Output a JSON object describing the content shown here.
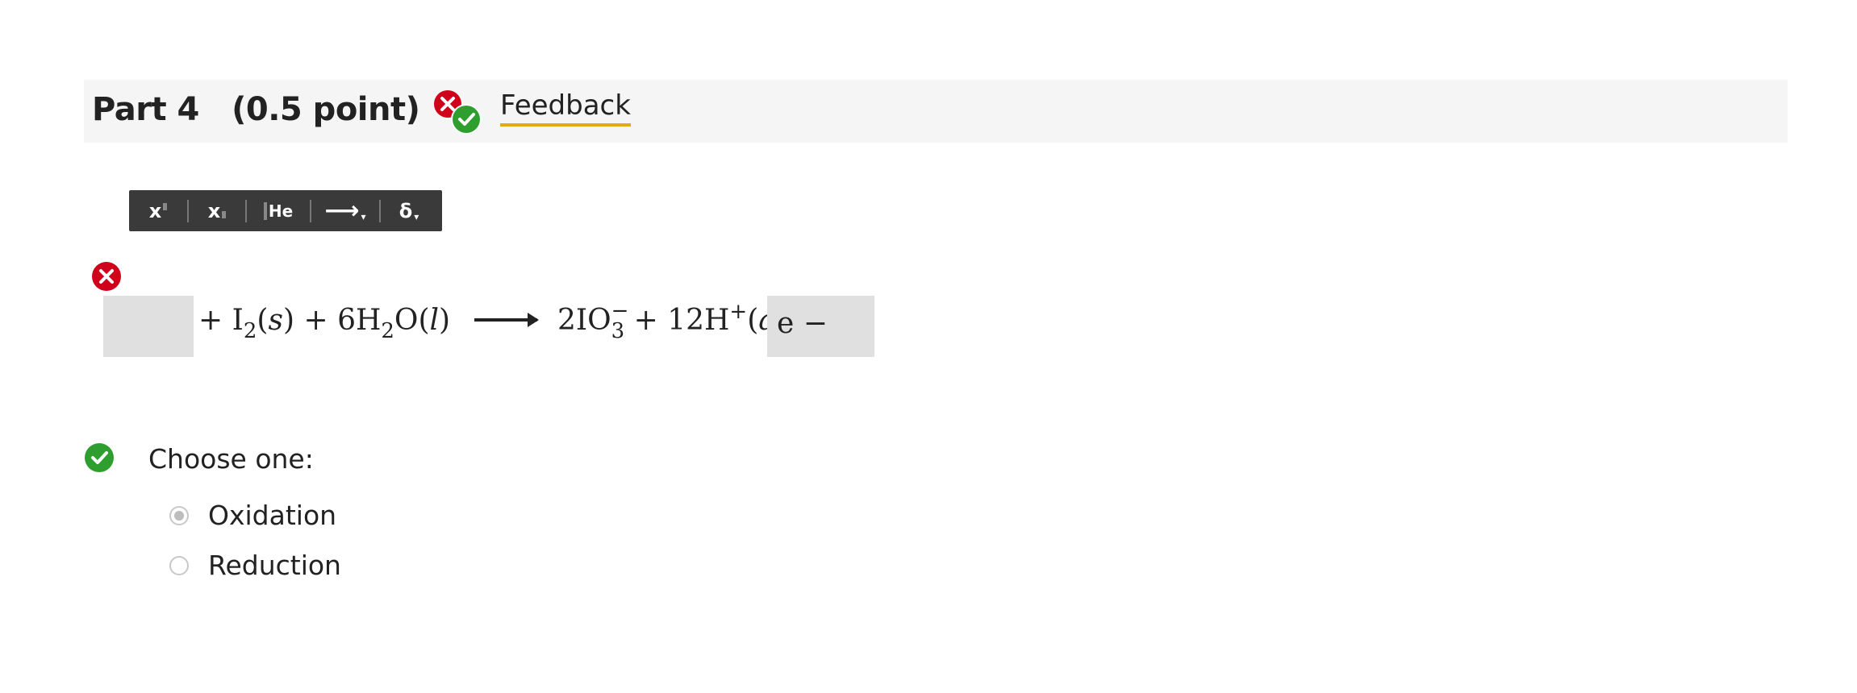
{
  "part": {
    "title": "Part 4   (0.5 point)",
    "feedback_label": "Feedback"
  },
  "toolbar": {
    "superscript_label": "x",
    "subscript_label": "x",
    "element_label": "He",
    "arrow_label": "⟶",
    "delta_label": "δ"
  },
  "equation": {
    "blank_left_value": "",
    "blank_right_value": "e −",
    "plus_1": "+",
    "i2": "I",
    "i2_sub": "2",
    "state_s": "s",
    "plus_2": "+",
    "water_coef": "6H",
    "water_sub": "2",
    "water_o": "O",
    "state_l": "l",
    "product_iodate_coef": "2IO",
    "iodate_sub": "3",
    "iodate_sup": "−",
    "plus_3": "+",
    "hydrogen": "12H",
    "hydrogen_sup": "+",
    "state_aq": "aq",
    "plus_4": "+"
  },
  "choice": {
    "prompt": "Choose one:",
    "options": [
      {
        "label": "Oxidation",
        "selected": true
      },
      {
        "label": "Reduction",
        "selected": false
      }
    ]
  },
  "colors": {
    "header_bg": "#f5f5f5",
    "feedback_underline": "#e6a817",
    "toolbar_bg": "#3a3a3a",
    "error_red": "#d0021b",
    "correct_green": "#2e9e2e",
    "answer_box_bg": "#e0e0e0"
  }
}
